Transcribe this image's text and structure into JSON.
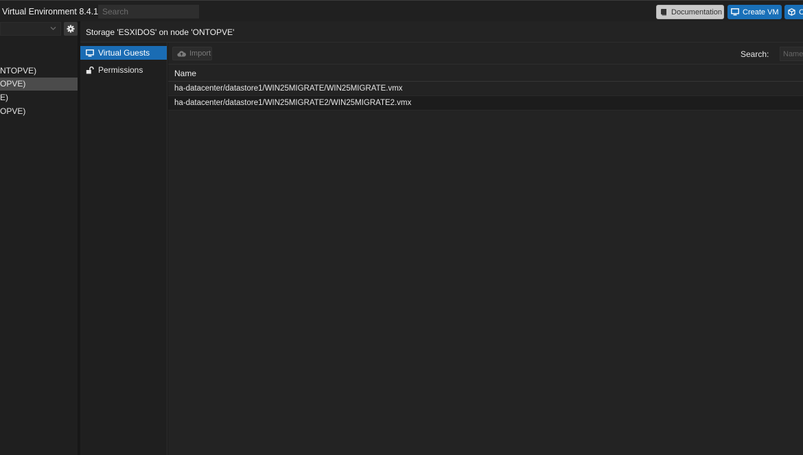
{
  "topbar": {
    "title": "Virtual Environment 8.4.1",
    "search_placeholder": "Search",
    "documentation_label": "Documentation",
    "create_vm_label": "Create VM",
    "create_ct_label": "C"
  },
  "tree": {
    "items": [
      {
        "label": "NTOPVE)",
        "selected": false
      },
      {
        "label": "OPVE)",
        "selected": true
      },
      {
        "label": "E)",
        "selected": false
      },
      {
        "label": "OPVE)",
        "selected": false
      }
    ]
  },
  "content": {
    "title": "Storage 'ESXIDOS' on node 'ONTOPVE'"
  },
  "subnav": {
    "items": [
      {
        "label": "Virtual Guests",
        "icon": "monitor-icon",
        "active": true
      },
      {
        "label": "Permissions",
        "icon": "unlock-icon",
        "active": false
      }
    ]
  },
  "grid": {
    "import_label": "Import",
    "search_label": "Search:",
    "filter_placeholder": "Name",
    "column_name": "Name",
    "rows": [
      "ha-datacenter/datastore1/WIN25MIGRATE/WIN25MIGRATE.vmx",
      "ha-datacenter/datastore1/WIN25MIGRATE2/WIN25MIGRATE2.vmx"
    ]
  },
  "colors": {
    "accent": "#1a6cb4",
    "background": "#1b1b1b"
  }
}
